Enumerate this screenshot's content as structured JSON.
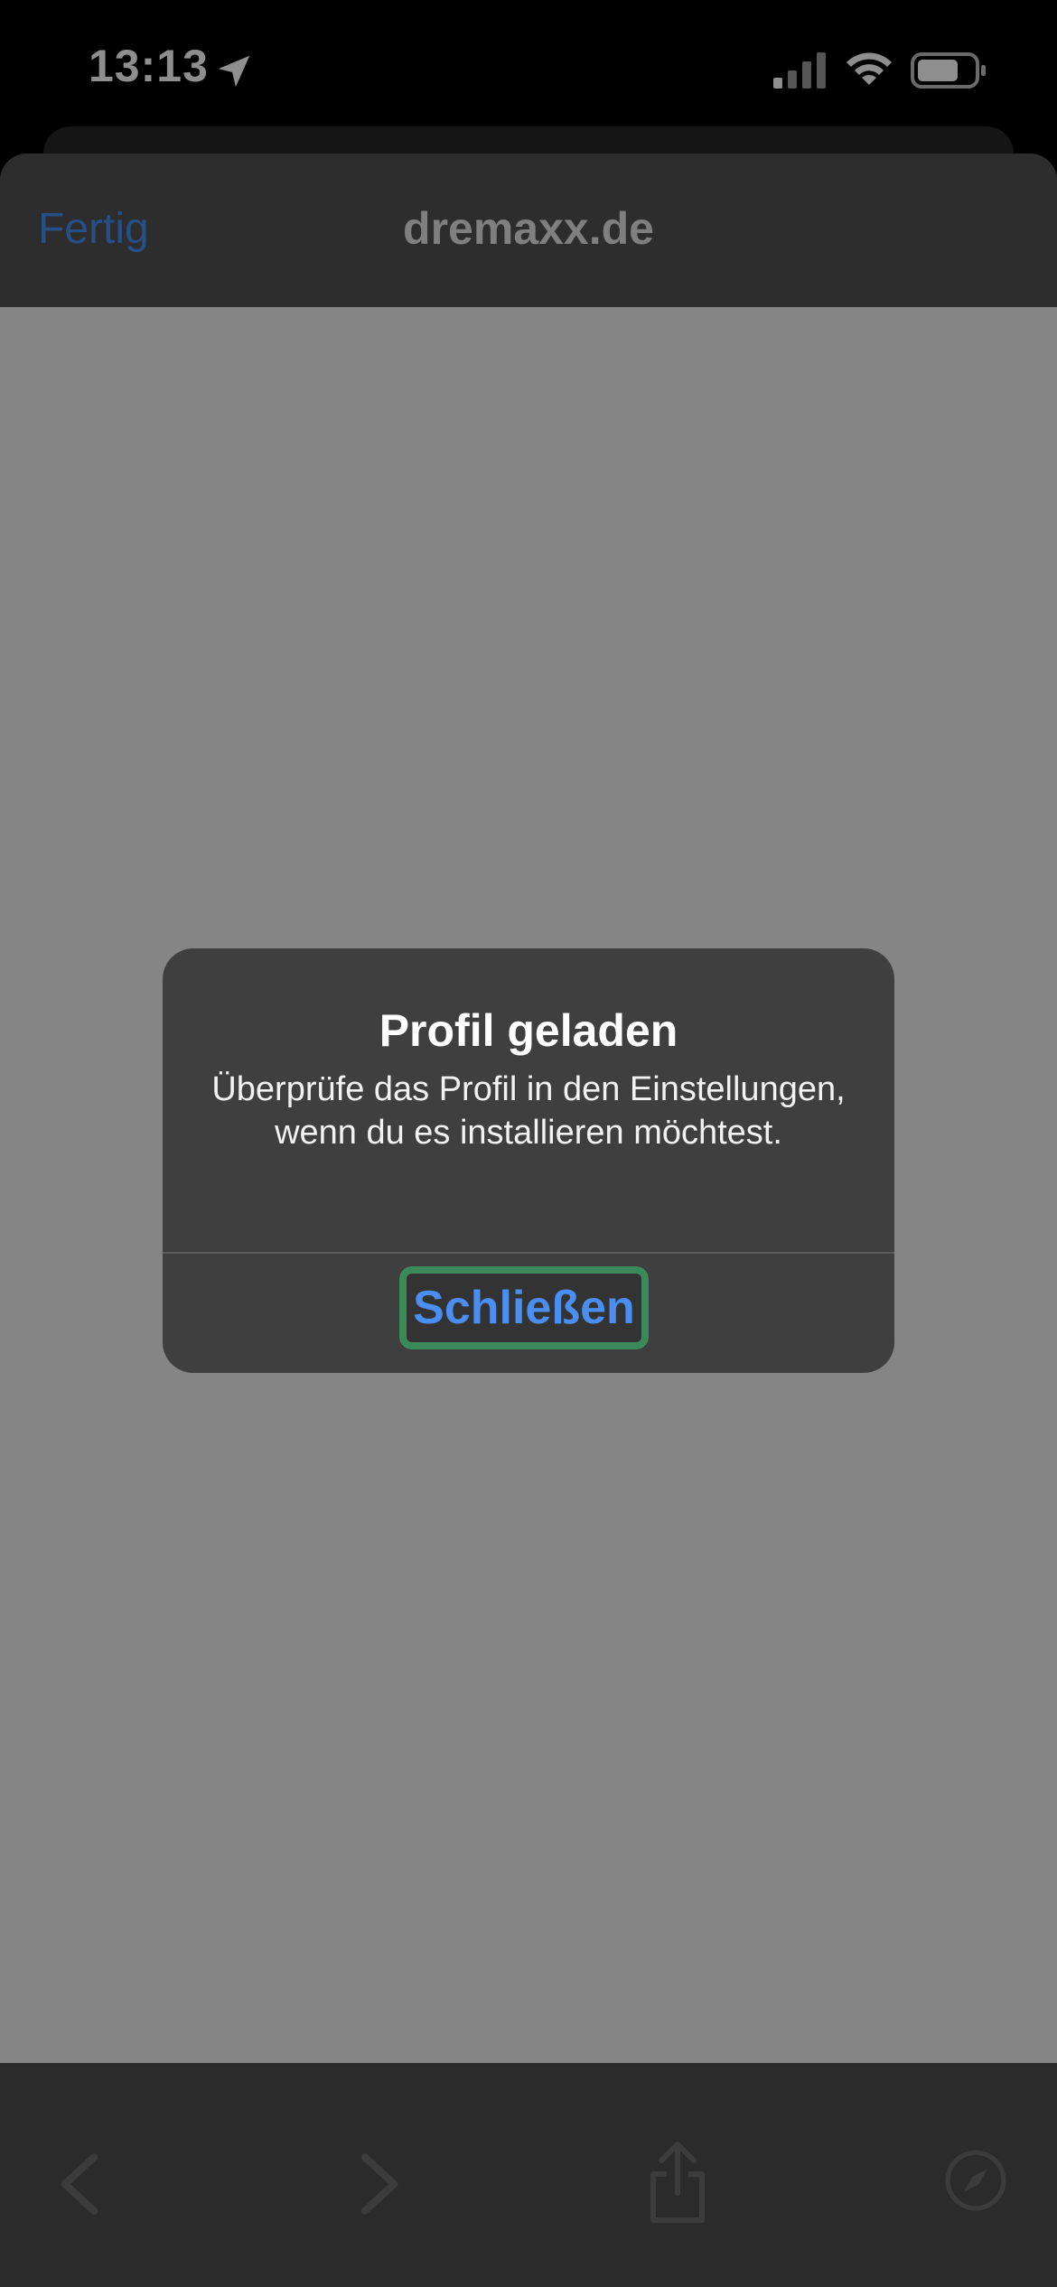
{
  "status_bar": {
    "time": "13:13"
  },
  "nav_bar": {
    "done_label": "Fertig",
    "title": "dremaxx.de"
  },
  "alert": {
    "title": "Profil geladen",
    "message": "Überprüfe das Profil in den Einstellungen, wenn du es installieren möchtest.",
    "close_label": "Schließen"
  },
  "colors": {
    "accent": "#4a8ef0",
    "highlight_border": "#3a8a5a",
    "web_content_bg": "#858585",
    "alert_bg": "#3f3f3f"
  },
  "icons": {
    "status": [
      "location-arrow-icon",
      "cellular-signal-icon",
      "wifi-icon",
      "battery-icon"
    ],
    "toolbar": [
      "back-chevron-icon",
      "forward-chevron-icon",
      "share-icon",
      "compass-icon"
    ]
  }
}
